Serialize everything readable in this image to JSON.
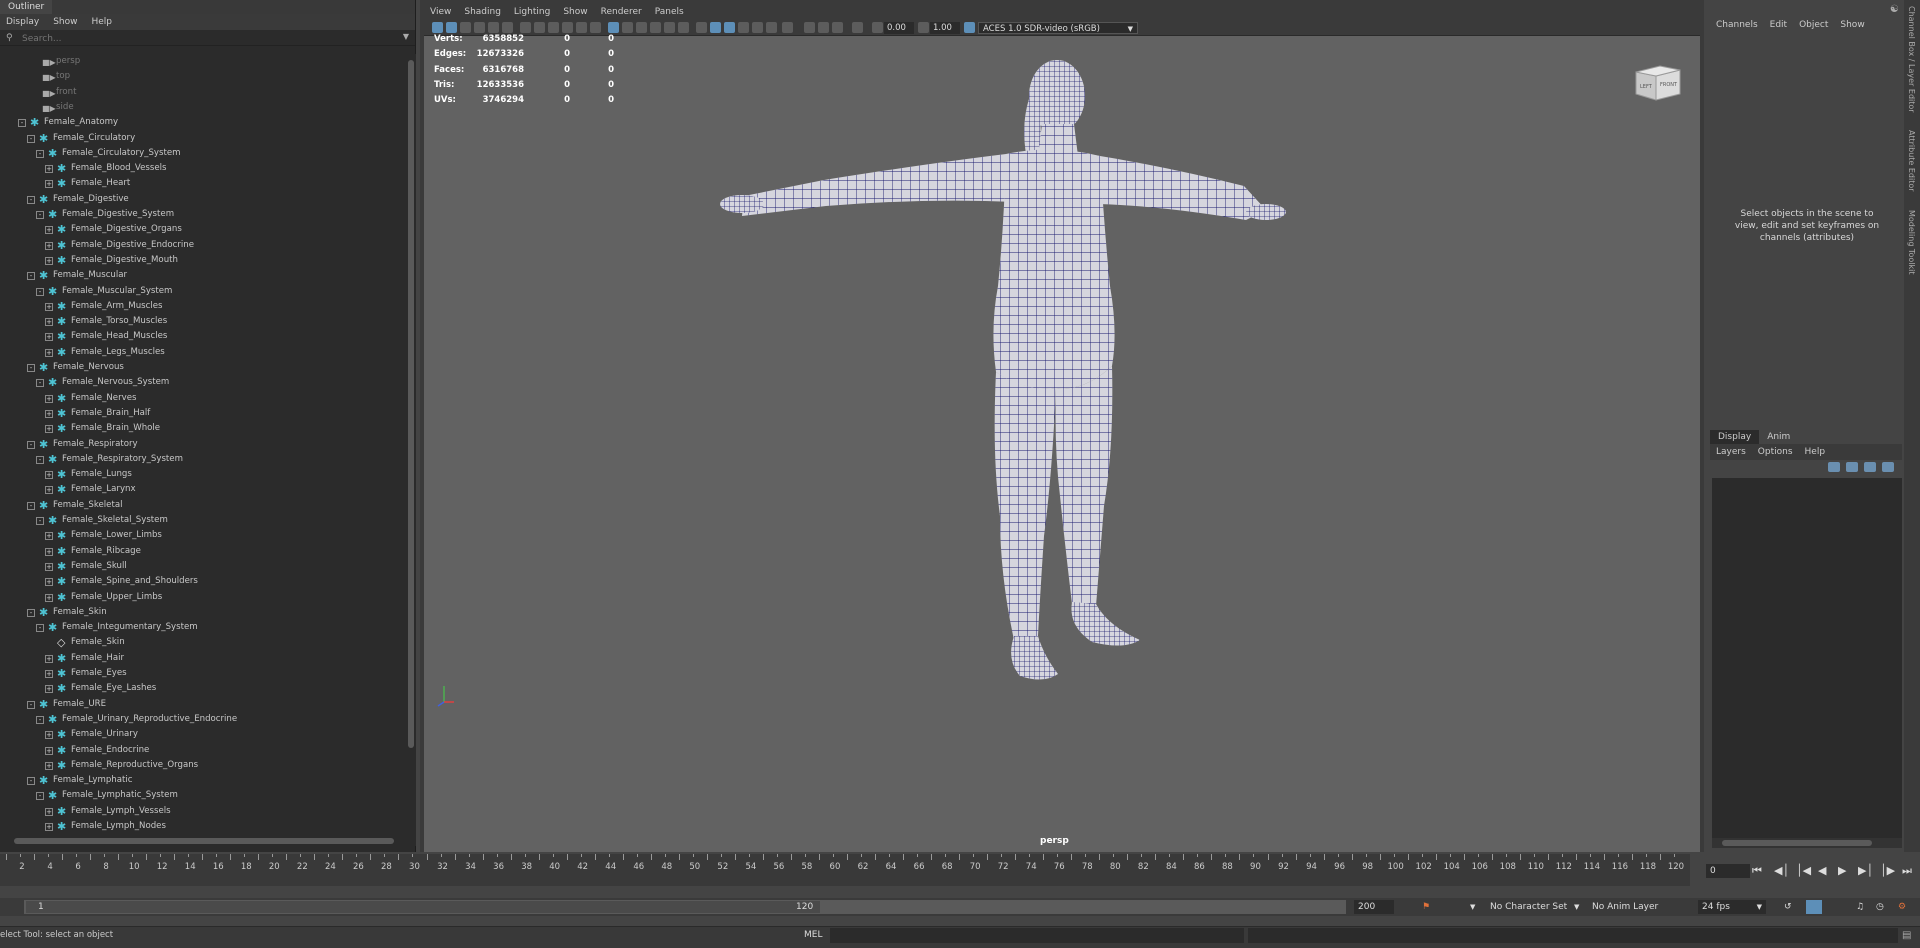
{
  "outliner": {
    "tab_title": "Outliner",
    "menu": [
      "Display",
      "Show",
      "Help"
    ],
    "search_placeholder": "Search...",
    "items": [
      {
        "label": "persp",
        "kind": "camera",
        "level": 0
      },
      {
        "label": "top",
        "kind": "camera",
        "level": 0
      },
      {
        "label": "front",
        "kind": "camera",
        "level": 0
      },
      {
        "label": "side",
        "kind": "camera",
        "level": 0
      },
      {
        "label": "Female_Anatomy",
        "kind": "group",
        "level": 0,
        "expand": "-"
      },
      {
        "label": "Female_Circulatory",
        "kind": "group",
        "level": 1,
        "expand": "-"
      },
      {
        "label": "Female_Circulatory_System",
        "kind": "group",
        "level": 2,
        "expand": "-"
      },
      {
        "label": "Female_Blood_Vessels",
        "kind": "group",
        "level": 3,
        "expand": "+"
      },
      {
        "label": "Female_Heart",
        "kind": "group",
        "level": 3,
        "expand": "+"
      },
      {
        "label": "Female_Digestive",
        "kind": "group",
        "level": 1,
        "expand": "-"
      },
      {
        "label": "Female_Digestive_System",
        "kind": "group",
        "level": 2,
        "expand": "-"
      },
      {
        "label": "Female_Digestive_Organs",
        "kind": "group",
        "level": 3,
        "expand": "+"
      },
      {
        "label": "Female_Digestive_Endocrine",
        "kind": "group",
        "level": 3,
        "expand": "+"
      },
      {
        "label": "Female_Digestive_Mouth",
        "kind": "group",
        "level": 3,
        "expand": "+"
      },
      {
        "label": "Female_Muscular",
        "kind": "group",
        "level": 1,
        "expand": "-"
      },
      {
        "label": "Female_Muscular_System",
        "kind": "group",
        "level": 2,
        "expand": "-"
      },
      {
        "label": "Female_Arm_Muscles",
        "kind": "group",
        "level": 3,
        "expand": "+"
      },
      {
        "label": "Female_Torso_Muscles",
        "kind": "group",
        "level": 3,
        "expand": "+"
      },
      {
        "label": "Female_Head_Muscles",
        "kind": "group",
        "level": 3,
        "expand": "+"
      },
      {
        "label": "Female_Legs_Muscles",
        "kind": "group",
        "level": 3,
        "expand": "+"
      },
      {
        "label": "Female_Nervous",
        "kind": "group",
        "level": 1,
        "expand": "-"
      },
      {
        "label": "Female_Nervous_System",
        "kind": "group",
        "level": 2,
        "expand": "-"
      },
      {
        "label": "Female_Nerves",
        "kind": "group",
        "level": 3,
        "expand": "+"
      },
      {
        "label": "Female_Brain_Half",
        "kind": "group",
        "level": 3,
        "expand": "+"
      },
      {
        "label": "Female_Brain_Whole",
        "kind": "group",
        "level": 3,
        "expand": "+"
      },
      {
        "label": "Female_Respiratory",
        "kind": "group",
        "level": 1,
        "expand": "-"
      },
      {
        "label": "Female_Respiratory_System",
        "kind": "group",
        "level": 2,
        "expand": "-"
      },
      {
        "label": "Female_Lungs",
        "kind": "group",
        "level": 3,
        "expand": "+"
      },
      {
        "label": "Female_Larynx",
        "kind": "group",
        "level": 3,
        "expand": "+"
      },
      {
        "label": "Female_Skeletal",
        "kind": "group",
        "level": 1,
        "expand": "-"
      },
      {
        "label": "Female_Skeletal_System",
        "kind": "group",
        "level": 2,
        "expand": "-"
      },
      {
        "label": "Female_Lower_Limbs",
        "kind": "group",
        "level": 3,
        "expand": "+"
      },
      {
        "label": "Female_Ribcage",
        "kind": "group",
        "level": 3,
        "expand": "+"
      },
      {
        "label": "Female_Skull",
        "kind": "group",
        "level": 3,
        "expand": "+"
      },
      {
        "label": "Female_Spine_and_Shoulders",
        "kind": "group",
        "level": 3,
        "expand": "+"
      },
      {
        "label": "Female_Upper_Limbs",
        "kind": "group",
        "level": 3,
        "expand": "+"
      },
      {
        "label": "Female_Skin",
        "kind": "group",
        "level": 1,
        "expand": "-"
      },
      {
        "label": "Female_Integumentary_System",
        "kind": "group",
        "level": 2,
        "expand": "-"
      },
      {
        "label": "Female_Skin",
        "kind": "mesh",
        "level": 3,
        "expand": ""
      },
      {
        "label": "Female_Hair",
        "kind": "group",
        "level": 3,
        "expand": "+"
      },
      {
        "label": "Female_Eyes",
        "kind": "group",
        "level": 3,
        "expand": "+"
      },
      {
        "label": "Female_Eye_Lashes",
        "kind": "group",
        "level": 3,
        "expand": "+"
      },
      {
        "label": "Female_URE",
        "kind": "group",
        "level": 1,
        "expand": "-"
      },
      {
        "label": "Female_Urinary_Reproductive_Endocrine",
        "kind": "group",
        "level": 2,
        "expand": "-"
      },
      {
        "label": "Female_Urinary",
        "kind": "group",
        "level": 3,
        "expand": "+"
      },
      {
        "label": "Female_Endocrine",
        "kind": "group",
        "level": 3,
        "expand": "+"
      },
      {
        "label": "Female_Reproductive_Organs",
        "kind": "group",
        "level": 3,
        "expand": "+"
      },
      {
        "label": "Female_Lymphatic",
        "kind": "group",
        "level": 1,
        "expand": "-"
      },
      {
        "label": "Female_Lymphatic_System",
        "kind": "group",
        "level": 2,
        "expand": "-"
      },
      {
        "label": "Female_Lymph_Vessels",
        "kind": "group",
        "level": 3,
        "expand": "+"
      },
      {
        "label": "Female_Lymph_Nodes",
        "kind": "group",
        "level": 3,
        "expand": "+"
      }
    ]
  },
  "viewport": {
    "menu": [
      "View",
      "Shading",
      "Lighting",
      "Show",
      "Renderer",
      "Panels"
    ],
    "exposure": "0.00",
    "gamma": "1.00",
    "color_space": "ACES 1.0 SDR-video (sRGB)",
    "camera_label": "persp",
    "view_cube": {
      "left": "LEFT",
      "front": "FRONT"
    },
    "hud": [
      {
        "label": "Verts:",
        "total": "6358852",
        "sel": "0",
        "comp": "0"
      },
      {
        "label": "Edges:",
        "total": "12673326",
        "sel": "0",
        "comp": "0"
      },
      {
        "label": "Faces:",
        "total": "6316768",
        "sel": "0",
        "comp": "0"
      },
      {
        "label": "Tris:",
        "total": "12633536",
        "sel": "0",
        "comp": "0"
      },
      {
        "label": "UVs:",
        "total": "3746294",
        "sel": "0",
        "comp": "0"
      }
    ]
  },
  "channel_box": {
    "menu": [
      "Channels",
      "Edit",
      "Object",
      "Show"
    ],
    "message": "Select objects in the scene to view, edit and set keyframes on channels (attributes)",
    "side_tabs": [
      "Channel Box / Layer Editor",
      "Attribute Editor",
      "Modeling Toolkit"
    ]
  },
  "layer_editor": {
    "tabs": [
      "Display",
      "Anim"
    ],
    "menu": [
      "Layers",
      "Options",
      "Help"
    ]
  },
  "time_slider": {
    "ticks": [
      "2",
      "4",
      "6",
      "8",
      "10",
      "12",
      "14",
      "16",
      "18",
      "20",
      "22",
      "24",
      "26",
      "28",
      "30",
      "32",
      "34",
      "36",
      "38",
      "40",
      "42",
      "44",
      "46",
      "48",
      "50",
      "52",
      "54",
      "56",
      "58",
      "60",
      "62",
      "64",
      "66",
      "68",
      "70",
      "72",
      "74",
      "76",
      "78",
      "80",
      "82",
      "84",
      "86",
      "88",
      "90",
      "92",
      "94",
      "96",
      "98",
      "100",
      "102",
      "104",
      "106",
      "108",
      "110",
      "112",
      "114",
      "116",
      "118",
      "120"
    ],
    "current_frame": "0"
  },
  "range_slider": {
    "start": "1",
    "range_end": "120",
    "end": "200",
    "character_set": "No Character Set",
    "anim_layer": "No Anim Layer",
    "fps": "24 fps"
  },
  "status": {
    "help_line": "elect Tool: select an object",
    "mel_label": "MEL"
  },
  "colors": {
    "accent": "#5d8fb8",
    "group_icon": "#4ec3d3",
    "wireframe": "#1a1a6e",
    "mesh_fill": "#d6d6de"
  }
}
